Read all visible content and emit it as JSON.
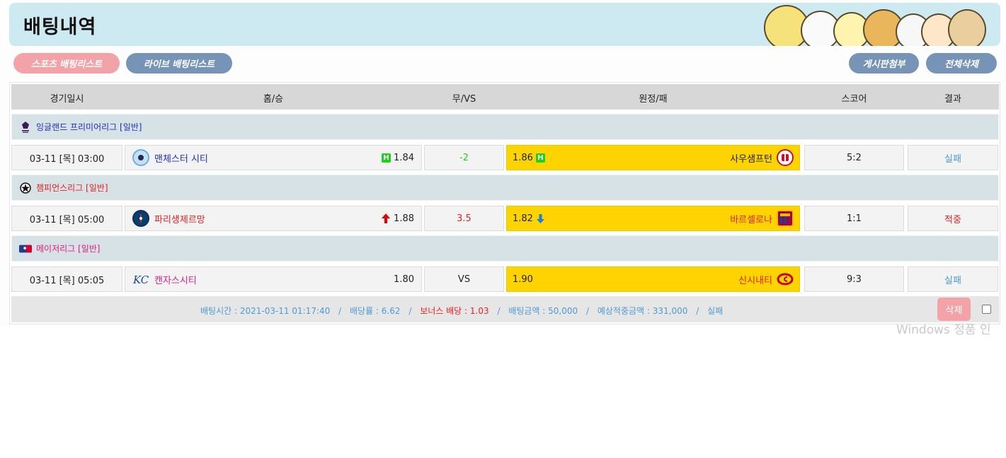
{
  "header": {
    "title": "배팅내역"
  },
  "nav": {
    "sports_label": "스포츠 배팅리스트",
    "live_label": "라이브 배팅리스트",
    "board_label": "게시판첨부",
    "delete_all_label": "전체삭제"
  },
  "columns": {
    "date": "경기일시",
    "home": "홈/승",
    "mid": "무/VS",
    "away": "원정/패",
    "score": "스코어",
    "result": "결과"
  },
  "groups": [
    {
      "league": "잉글랜드 프리미어리그 [일반]",
      "league_color": "#1f2fbf",
      "league_icon": "premier-league-icon",
      "date": "03-11 [목] 03:00",
      "home_team": "맨체스터 시티",
      "home_team_color": "#1f2fbf",
      "home_logo": "man-city-logo",
      "home_marker": "H",
      "home_odds": "1.84",
      "mid_value": "-2",
      "mid_color": "#1fd11f",
      "away_odds": "1.86",
      "away_marker": "H",
      "away_team": "사우샘프턴",
      "away_logo": "southampton-logo",
      "score": "5:2",
      "result": "실패",
      "result_color": "#4e9ad6"
    },
    {
      "league": "챔피언스리그 [일반]",
      "league_color": "#e62020",
      "league_icon": "champions-league-icon",
      "date": "03-11 [목] 05:00",
      "home_team": "파리생제르망",
      "home_team_color": "#e62020",
      "home_logo": "psg-logo",
      "home_marker": "up-arrow",
      "home_odds": "1.88",
      "mid_value": "3.5",
      "mid_color": "#e62020",
      "away_odds": "1.82",
      "away_marker": "down-arrow",
      "away_team": "바르셀로나",
      "away_logo": "barcelona-logo",
      "score": "1:1",
      "result": "적중",
      "result_color": "#e62020"
    },
    {
      "league": "메이저리그 [일반]",
      "league_color": "#e6197f",
      "league_icon": "mlb-icon",
      "date": "03-11 [목] 05:05",
      "home_team": "캔자스시티",
      "home_team_color": "#e6197f",
      "home_logo": "kansas-city-logo",
      "home_marker": "",
      "home_odds": "1.80",
      "mid_value": "VS",
      "mid_color": "#222222",
      "away_odds": "1.90",
      "away_marker": "",
      "away_team": "신시내티",
      "away_logo": "cincinnati-logo",
      "score": "9:3",
      "result": "실패",
      "result_color": "#4e9ad6"
    }
  ],
  "summary": {
    "bet_time": "배팅시간 : 2021-03-11 01:17:40",
    "odds": "배당률 : 6.62",
    "bonus": "보너스 배당 : 1.03",
    "amount": "배팅금액 : 50,000",
    "expected": "예상적중금액 : 331,000",
    "status": "실패",
    "delete_label": "삭제",
    "separator": "/"
  },
  "watermark": "Windows 정품 인",
  "colors": {
    "header_bg": "#cdeaf3",
    "pill_pink": "#f2a3a8",
    "pill_blue": "#7793b6",
    "highlight_yellow": "#fdd400",
    "league_bg": "#d6e2e6"
  }
}
